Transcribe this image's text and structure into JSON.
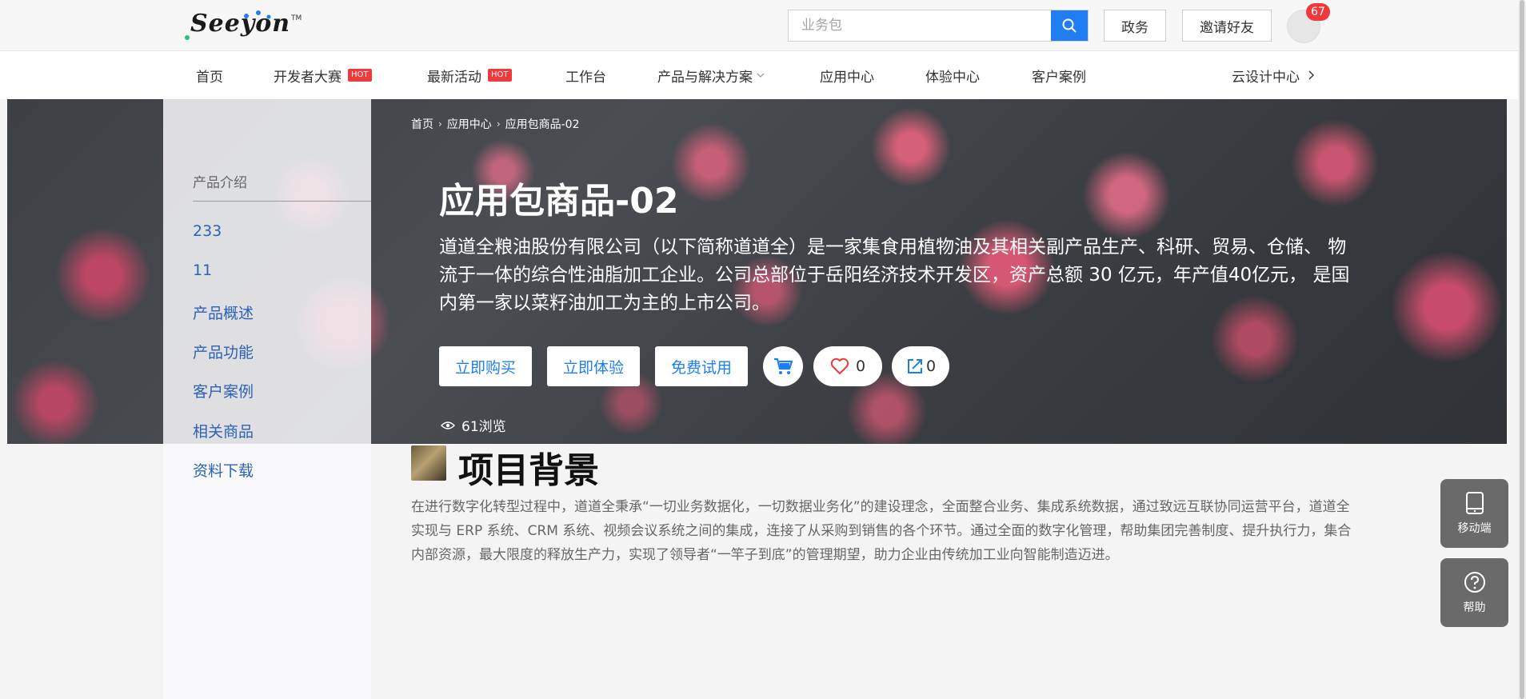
{
  "header": {
    "logo_text": "Seeyon",
    "search_placeholder": "业务包",
    "btn_gov": "政务",
    "btn_invite": "邀请好友",
    "notification_count": "67"
  },
  "nav": {
    "items": [
      "首页",
      "开发者大赛",
      "最新活动",
      "工作台",
      "产品与解决方案",
      "应用中心",
      "体验中心",
      "客户案例"
    ],
    "hot_label": "HOT",
    "right_link": "云设计中心"
  },
  "breadcrumb": [
    "首页",
    "应用中心",
    "应用包商品-02"
  ],
  "hero": {
    "title": "应用包商品-02",
    "description": "道道全粮油股份有限公司（以下简称道道全）是一家集食用植物油及其相关副产品生产、科研、贸易、仓储、 物流于一体的综合性油脂加工企业。公司总部位于岳阳经济技术开发区，资产总额 30 亿元，年产值40亿元， 是国内第一家以菜籽油加工为主的上市公司。",
    "btn_buy": "立即购买",
    "btn_experience": "立即体验",
    "btn_trial": "免费试用",
    "likes": "0",
    "shares": "0",
    "views": "61浏览"
  },
  "sidebar": {
    "heading": "产品介绍",
    "items": [
      "233",
      "11",
      "产品概述",
      "产品功能",
      "客户案例",
      "相关商品",
      "资料下载"
    ]
  },
  "section": {
    "title": "项目背景",
    "text": "在进行数字化转型过程中，道道全秉承“一切业务数据化，一切数据业务化”的建设理念，全面整合业务、集成系统数据，通过致远互联协同运营平台，道道全实现与 ERP 系统、CRM 系统、视频会议系统之间的集成，连接了从采购到销售的各个环节。通过全面的数字化管理，帮助集团完善制度、提升执行力，集合内部资源，最大限度的释放生产力，实现了领导者“一竿子到底”的管理期望，助力企业由传统加工业向智能制造迈进。"
  },
  "floating": {
    "mobile": "移动端",
    "help": "帮助"
  },
  "colors": {
    "accent": "#1f7ff2",
    "hot": "#f0393b",
    "sidebar_link": "#2b62b6"
  }
}
